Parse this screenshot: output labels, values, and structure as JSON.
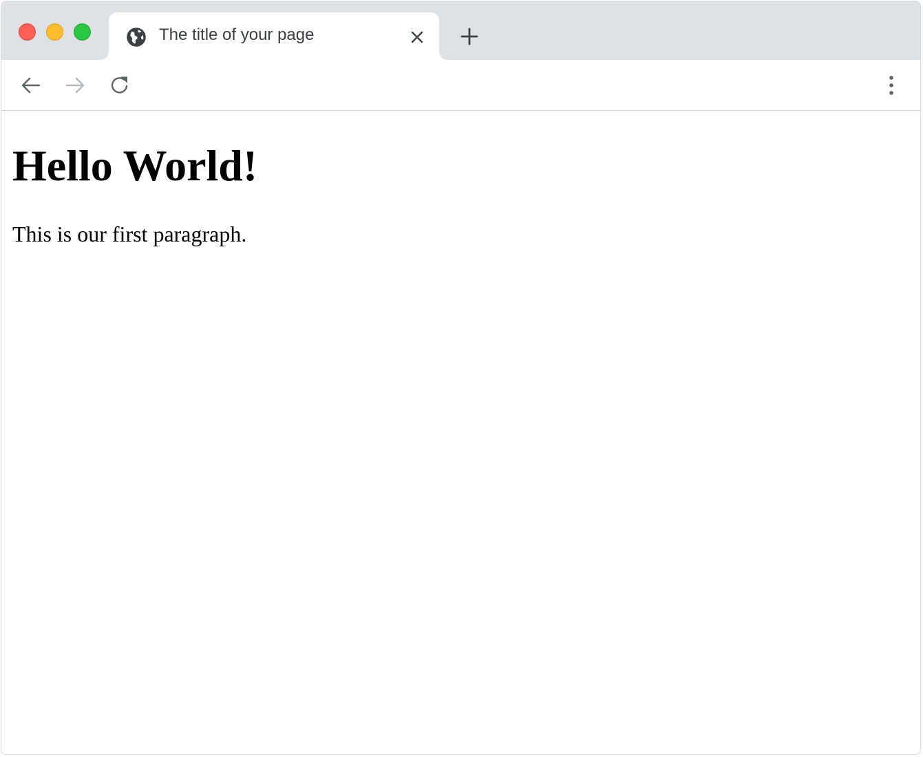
{
  "window": {
    "traffic_lights": {
      "close_color": "#ff5f57",
      "minimize_color": "#febc2e",
      "zoom_color": "#28c840"
    }
  },
  "tab": {
    "title": "The title of your page",
    "favicon": "globe-icon",
    "close_icon": "close-icon"
  },
  "tabstrip": {
    "new_tab_icon": "plus-icon"
  },
  "toolbar": {
    "back_icon": "arrow-left-icon",
    "forward_icon": "arrow-right-icon",
    "forward_enabled": false,
    "reload_icon": "reload-icon",
    "menu_icon": "more-vertical-icon"
  },
  "page": {
    "heading": "Hello World!",
    "paragraph": "This is our first paragraph."
  }
}
